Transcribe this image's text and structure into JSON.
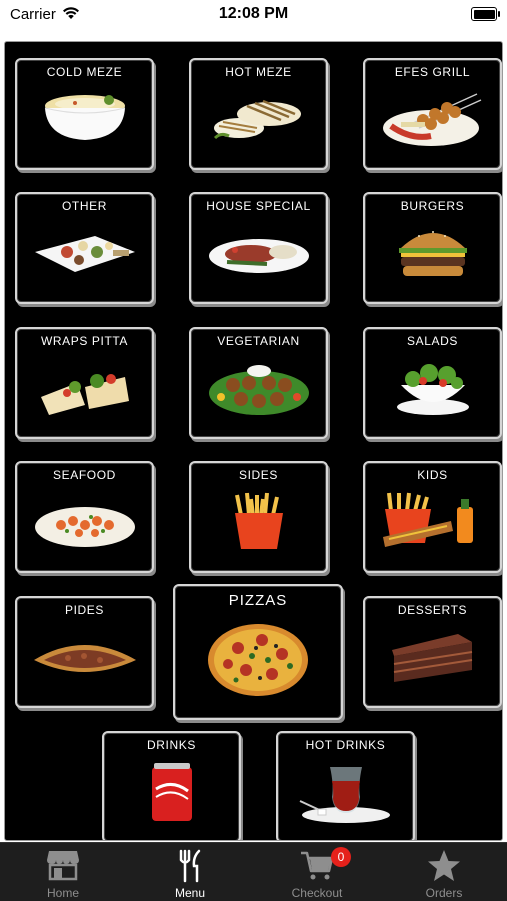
{
  "status_bar": {
    "carrier": "Carrier",
    "time": "12:08 PM",
    "battery_level": 1.0
  },
  "categories": [
    {
      "label": "COLD MEZE"
    },
    {
      "label": "HOT MEZE"
    },
    {
      "label": "EFES GRILL"
    },
    {
      "label": "OTHER"
    },
    {
      "label": "HOUSE SPECIAL"
    },
    {
      "label": "BURGERS"
    },
    {
      "label": "WRAPS PITTA"
    },
    {
      "label": "VEGETARIAN"
    },
    {
      "label": "SALADS"
    },
    {
      "label": "SEAFOOD"
    },
    {
      "label": "SIDES"
    },
    {
      "label": "KIDS"
    },
    {
      "label": "PIDES"
    },
    {
      "label": "PIZZAS"
    },
    {
      "label": "DESSERTS"
    },
    {
      "label": "DRINKS"
    },
    {
      "label": "HOT DRINKS"
    }
  ],
  "tabbar": {
    "home": "Home",
    "menu": "Menu",
    "checkout": "Checkout",
    "checkout_badge": "0",
    "orders": "Orders",
    "active": "menu"
  },
  "colors": {
    "panel": "#000000",
    "tabbar": "#1e1e1e",
    "badge": "#e5211b",
    "tab_inactive": "#8e8e8e"
  }
}
